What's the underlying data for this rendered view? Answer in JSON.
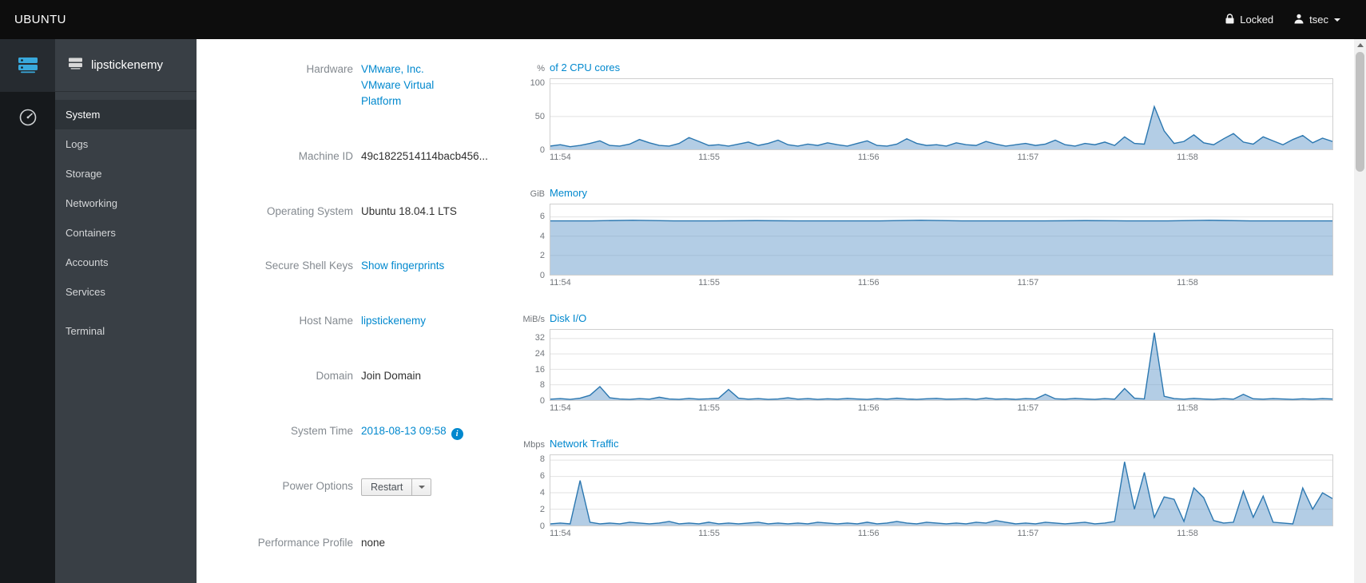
{
  "topbar": {
    "brand": "UBUNTU",
    "locked_label": "Locked",
    "user": "tsec"
  },
  "sidebar": {
    "hostname": "lipstickenemy",
    "items": [
      {
        "label": "System",
        "active": true
      },
      {
        "label": "Logs"
      },
      {
        "label": "Storage"
      },
      {
        "label": "Networking"
      },
      {
        "label": "Containers"
      },
      {
        "label": "Accounts"
      },
      {
        "label": "Services"
      },
      {
        "label": "Terminal",
        "separated": true
      }
    ]
  },
  "details": {
    "hardware_label": "Hardware",
    "hardware_value": "VMware, Inc. VMware Virtual Platform",
    "machine_id_label": "Machine ID",
    "machine_id_value": "49c1822514114bacb456...",
    "os_label": "Operating System",
    "os_value": "Ubuntu 18.04.1 LTS",
    "ssh_label": "Secure Shell Keys",
    "ssh_value": "Show fingerprints",
    "hostname_label": "Host Name",
    "hostname_value": "lipstickenemy",
    "domain_label": "Domain",
    "domain_value": "Join Domain",
    "time_label": "System Time",
    "time_value": "2018-08-13 09:58",
    "power_label": "Power Options",
    "power_button": "Restart",
    "profile_label": "Performance Profile",
    "profile_value": "none"
  },
  "colors": {
    "accent": "#0088ce",
    "chart_line": "#2b77b0",
    "chart_fill": "rgba(103,156,203,0.5)",
    "grid": "#e2e2e2"
  },
  "chart_data": [
    {
      "type": "area",
      "title": "of 2 CPU cores",
      "unit": "%",
      "ylim": [
        0,
        107
      ],
      "yticks": [
        0,
        50,
        100
      ],
      "xticks": [
        "11:54",
        "11:55",
        "11:56",
        "11:57",
        "11:58"
      ],
      "values": [
        5,
        7,
        4,
        6,
        9,
        13,
        6,
        5,
        8,
        15,
        10,
        6,
        5,
        9,
        18,
        12,
        6,
        7,
        5,
        8,
        11,
        6,
        9,
        14,
        7,
        5,
        8,
        6,
        10,
        7,
        5,
        9,
        13,
        6,
        5,
        8,
        16,
        9,
        6,
        7,
        5,
        10,
        7,
        6,
        12,
        8,
        5,
        7,
        9,
        6,
        8,
        14,
        7,
        5,
        9,
        7,
        11,
        6,
        19,
        9,
        8,
        65,
        28,
        9,
        12,
        22,
        10,
        7,
        16,
        24,
        11,
        8,
        19,
        13,
        7,
        15,
        21,
        10,
        17,
        12
      ]
    },
    {
      "type": "area",
      "title": "Memory",
      "unit": "GiB",
      "ylim": [
        0,
        7.3
      ],
      "yticks": [
        0,
        2,
        4,
        6
      ],
      "xticks": [
        "11:54",
        "11:55",
        "11:56",
        "11:57",
        "11:58"
      ],
      "values": [
        5.6,
        5.6,
        5.65,
        5.6,
        5.6,
        5.62,
        5.6,
        5.6,
        5.6,
        5.65,
        5.6,
        5.6,
        5.6,
        5.62,
        5.6,
        5.6,
        5.65,
        5.6,
        5.6,
        5.6
      ]
    },
    {
      "type": "area",
      "title": "Disk I/O",
      "unit": "MiB/s",
      "ylim": [
        0,
        36.5
      ],
      "yticks": [
        0,
        8,
        16,
        24,
        32
      ],
      "xticks": [
        "11:54",
        "11:55",
        "11:56",
        "11:57",
        "11:58"
      ],
      "values": [
        0.5,
        0.8,
        0.4,
        1.0,
        2.5,
        7.0,
        1.2,
        0.6,
        0.4,
        0.8,
        0.5,
        1.5,
        0.6,
        0.4,
        0.9,
        0.5,
        0.7,
        1.0,
        5.5,
        1.0,
        0.5,
        0.8,
        0.4,
        0.6,
        1.2,
        0.5,
        0.8,
        0.4,
        0.7,
        0.5,
        0.9,
        0.6,
        0.4,
        0.8,
        0.5,
        1.0,
        0.6,
        0.4,
        0.7,
        0.9,
        0.5,
        0.6,
        0.8,
        0.4,
        1.1,
        0.5,
        0.7,
        0.4,
        0.8,
        0.6,
        3.0,
        0.7,
        0.5,
        0.9,
        0.6,
        0.4,
        0.8,
        0.5,
        6.0,
        1.0,
        0.6,
        35.0,
        2.0,
        0.8,
        0.5,
        0.9,
        0.6,
        0.4,
        0.8,
        0.5,
        3.0,
        0.7,
        0.5,
        0.8,
        0.6,
        0.4,
        0.7,
        0.5,
        0.8,
        0.6
      ]
    },
    {
      "type": "area",
      "title": "Network Traffic",
      "unit": "Mbps",
      "ylim": [
        0,
        8.6
      ],
      "yticks": [
        0,
        2,
        4,
        6,
        8
      ],
      "xticks": [
        "11:54",
        "11:55",
        "11:56",
        "11:57",
        "11:58"
      ],
      "values": [
        0.2,
        0.3,
        0.2,
        5.5,
        0.4,
        0.2,
        0.3,
        0.2,
        0.4,
        0.3,
        0.2,
        0.3,
        0.5,
        0.2,
        0.3,
        0.2,
        0.4,
        0.2,
        0.3,
        0.2,
        0.3,
        0.4,
        0.2,
        0.3,
        0.2,
        0.3,
        0.2,
        0.4,
        0.3,
        0.2,
        0.3,
        0.2,
        0.4,
        0.2,
        0.3,
        0.5,
        0.3,
        0.2,
        0.4,
        0.3,
        0.2,
        0.3,
        0.2,
        0.4,
        0.3,
        0.6,
        0.4,
        0.2,
        0.3,
        0.2,
        0.4,
        0.3,
        0.2,
        0.3,
        0.4,
        0.2,
        0.3,
        0.5,
        7.8,
        2.0,
        6.5,
        1.0,
        3.5,
        3.2,
        0.5,
        4.6,
        3.4,
        0.6,
        0.3,
        0.4,
        4.2,
        1.0,
        3.6,
        0.4,
        0.3,
        0.2,
        4.6,
        2.0,
        4.0,
        3.3
      ]
    }
  ]
}
